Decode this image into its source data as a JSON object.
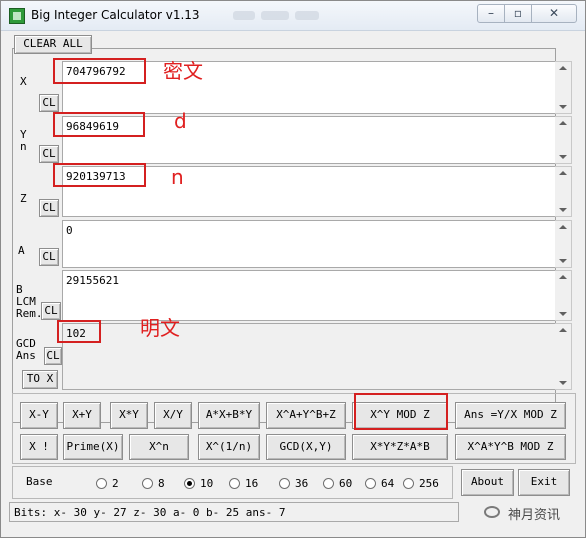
{
  "window": {
    "title": "Big Integer Calculator v1.13",
    "min_label": "–",
    "max_label": "▫",
    "close_label": "✕"
  },
  "toolbar": {
    "clear_all": "CLEAR ALL"
  },
  "fields": {
    "x": {
      "label": "X",
      "value": "704796792"
    },
    "y": {
      "label": "Y\nn",
      "value": "96849619"
    },
    "z": {
      "label": "Z",
      "value": "920139713"
    },
    "a": {
      "label": "A",
      "value": "0"
    },
    "b": {
      "label": "B\nLCM\nRem.",
      "value": "29155621"
    },
    "ans": {
      "label": "GCD\nAns",
      "value": "102"
    }
  },
  "cl_label": "CL",
  "to_x_label": "TO X",
  "annotations": {
    "x": "密文",
    "y": "d",
    "z": "n",
    "ans": "明文"
  },
  "buttons": {
    "row1": [
      "X-Y",
      "X+Y",
      "X*Y",
      "X/Y",
      "A*X+B*Y",
      "X^A+Y^B+Z",
      "X^Y MOD Z",
      "Ans =Y/X MOD Z"
    ],
    "row2": [
      "X !",
      "Prime(X)",
      "X^n",
      "X^(1/n)",
      "GCD(X,Y)",
      "X*Y*Z*A*B",
      "X^A*Y^B MOD Z"
    ]
  },
  "base": {
    "label": "Base",
    "options": [
      "2",
      "8",
      "10",
      "16",
      "36",
      "60",
      "64",
      "256"
    ],
    "selected": "10"
  },
  "about_label": "About",
  "exit_label": "Exit",
  "status": "Bits: x- 30 y- 27 z- 30 a- 0 b- 25 ans- 7",
  "watermark": "神月资讯"
}
